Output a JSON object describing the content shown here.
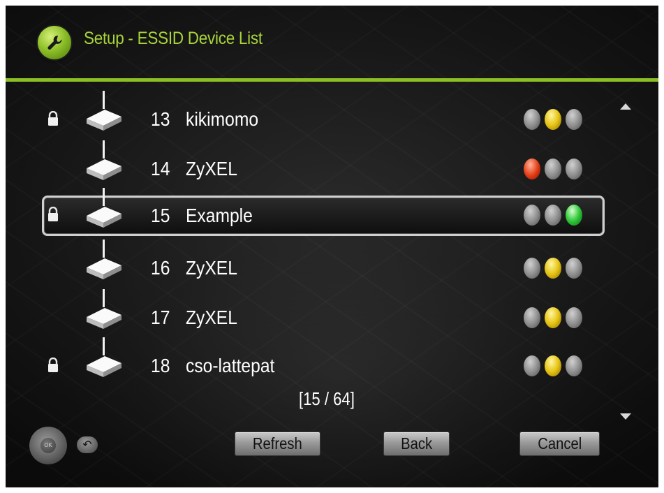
{
  "header": {
    "title": "Setup - ESSID Device List",
    "icon": "wrench-icon",
    "accent": "#8cbf26"
  },
  "devices": [
    {
      "number": "13",
      "name": "kikimomo",
      "locked": true,
      "signal": [
        "gray",
        "yellow",
        "gray"
      ]
    },
    {
      "number": "14",
      "name": "ZyXEL",
      "locked": false,
      "signal": [
        "red",
        "gray",
        "gray"
      ]
    },
    {
      "number": "15",
      "name": "Example",
      "locked": true,
      "signal": [
        "gray",
        "gray",
        "green"
      ],
      "selected": true
    },
    {
      "number": "16",
      "name": "ZyXEL",
      "locked": false,
      "signal": [
        "gray",
        "yellow",
        "gray"
      ]
    },
    {
      "number": "17",
      "name": "ZyXEL",
      "locked": false,
      "signal": [
        "gray",
        "yellow",
        "gray"
      ]
    },
    {
      "number": "18",
      "name": "cso-lattepat",
      "locked": true,
      "signal": [
        "gray",
        "yellow",
        "gray"
      ]
    }
  ],
  "pagination": {
    "indicator": "[15 / 64]"
  },
  "buttons": {
    "refresh": "Refresh",
    "back": "Back",
    "cancel": "Cancel"
  },
  "hints": {
    "dpad_label": "OK",
    "dpad_icon": "remote-dpad-icon",
    "back_icon": "return-arrow-icon"
  }
}
